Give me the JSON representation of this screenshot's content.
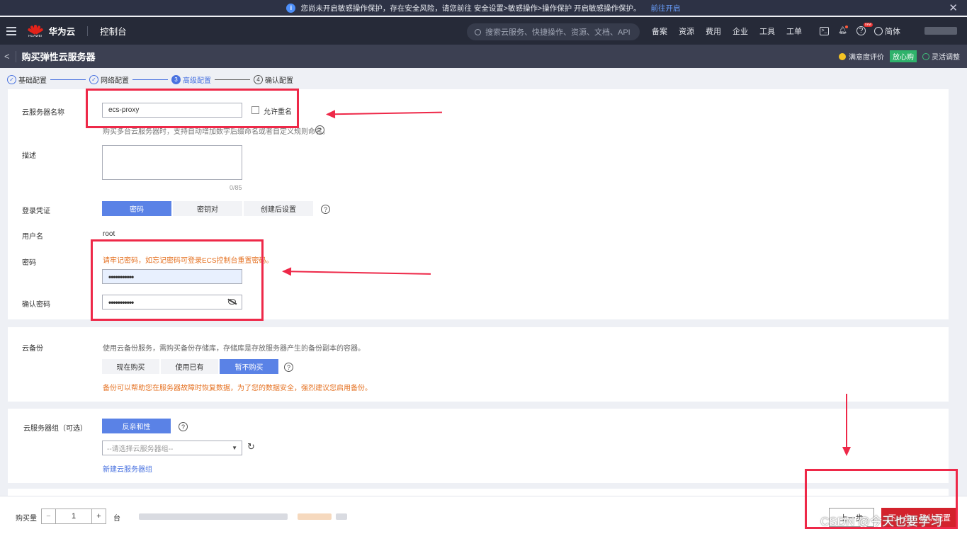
{
  "banner": {
    "text": "您尚未开启敏感操作保护，存在安全风险，请您前往 安全设置>敏感操作>操作保护 开启敏感操作保护。",
    "link": "前往开启"
  },
  "topnav": {
    "logo_text": "HUAWEI",
    "brand": "华为云",
    "console": "控制台",
    "search_placeholder": "搜索云服务、快捷操作、资源、文档、API",
    "links": [
      "备案",
      "资源",
      "费用",
      "企业",
      "工具",
      "工单"
    ],
    "lang": "简体"
  },
  "titlebar": {
    "back": "<",
    "title": "购买弹性云服务器",
    "satisfaction": "满意度评价",
    "badge": "放心购",
    "flexible": "灵活调整"
  },
  "steps": [
    {
      "num": "✓",
      "label": "基础配置"
    },
    {
      "num": "✓",
      "label": "网络配置"
    },
    {
      "num": "3",
      "label": "高级配置"
    },
    {
      "num": "4",
      "label": "确认配置"
    }
  ],
  "server": {
    "name_label": "云服务器名称",
    "name_value": "ecs-proxy",
    "allow_dup": "允许重名",
    "name_hint": "购买多台云服务器时，支持自动增加数字后缀命名或者自定义规则命名。",
    "desc_label": "描述",
    "desc_count": "0/85",
    "login_label": "登录凭证",
    "login_options": [
      "密码",
      "密钥对",
      "创建后设置"
    ],
    "user_label": "用户名",
    "user_value": "root",
    "pwd_label": "密码",
    "pwd_warn": "请牢记密码，如忘记密码可登录ECS控制台重置密码。",
    "pwd_value": "•••••••••••",
    "confirm_label": "确认密码",
    "confirm_value": "•••••••••••"
  },
  "backup": {
    "label": "云备份",
    "desc": "使用云备份服务，需购买备份存储库，存储库是存放服务器产生的备份副本的容器。",
    "options": [
      "现在购买",
      "使用已有",
      "暂不购买"
    ],
    "warn": "备份可以帮助您在服务器故障时恢复数据，为了您的数据安全，强烈建议您启用备份。"
  },
  "group": {
    "label": "云服务器组（可选）",
    "policy": "反亲和性",
    "select_placeholder": "--请选择云服务器组--",
    "new_link": "新建云服务器组"
  },
  "bottom": {
    "qty_label": "购买量",
    "qty": "1",
    "unit": "台",
    "prev": "上一步",
    "next": "下一步：确认配置"
  },
  "watermark": "CSDN @今天也要学习"
}
